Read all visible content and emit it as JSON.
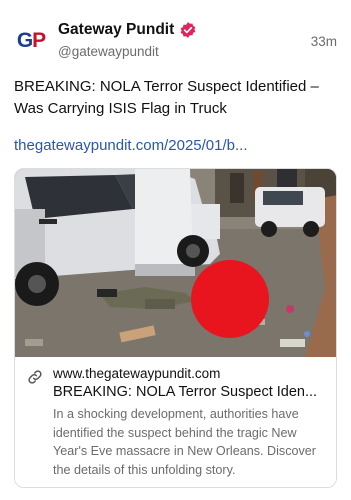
{
  "post": {
    "author": {
      "display_name": "Gateway Pundit",
      "handle": "@gatewaypundit",
      "avatar_letters": [
        "G",
        "P"
      ],
      "verified": true
    },
    "time": "33m",
    "text": "BREAKING: NOLA Terror Suspect Identified – Was Carrying ISIS Flag in Truck",
    "link": "thegatewaypundit.com/2025/01/b..."
  },
  "card": {
    "domain": "www.thegatewaypundit.com",
    "title": "BREAKING: NOLA Terror Suspect Iden...",
    "description": "In a shocking development, authorities have identified the suspect behind the tragic New Year's Eve massacre in New Orleans. Discover the details of this unfolding story.",
    "link_icon": "link-icon"
  },
  "colors": {
    "verified_badge": "#e0245e",
    "link": "#2a57a8",
    "redaction": "#e8141e"
  }
}
